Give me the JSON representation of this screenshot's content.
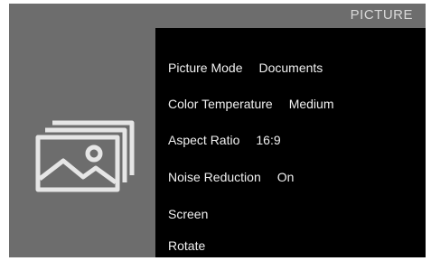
{
  "header": {
    "title": "PICTURE"
  },
  "category_icon": {
    "icon": "pictures-icon"
  },
  "menu": {
    "items": [
      {
        "label": "Picture Mode",
        "value": "Documents"
      },
      {
        "label": "Color Temperature",
        "value": "Medium"
      },
      {
        "label": "Aspect Ratio",
        "value": "16:9"
      },
      {
        "label": "Noise Reduction",
        "value": "On"
      },
      {
        "label": "Screen",
        "value": ""
      },
      {
        "label": "Rotate",
        "value": ""
      }
    ]
  },
  "colors": {
    "panel_background": "#000000",
    "screen_background": "#6d6d6d",
    "text": "#f0f0f0"
  }
}
